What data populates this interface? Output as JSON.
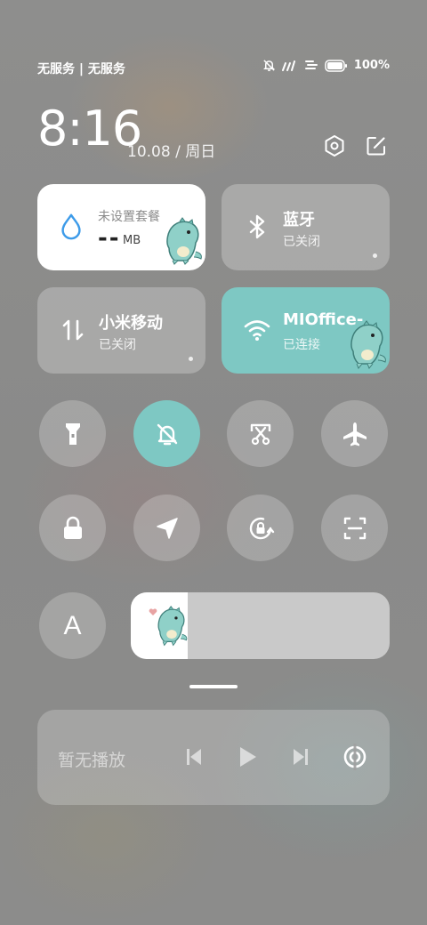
{
  "status_bar": {
    "carrier": "无服务 | 无服务",
    "battery_percent": "100%",
    "icons": [
      "dnd-off-icon",
      "signal-icon",
      "data-icon",
      "battery-icon"
    ]
  },
  "header": {
    "time": "8:16",
    "date": "10.08 / 周日",
    "icons": [
      "settings-icon",
      "edit-icon"
    ]
  },
  "tiles": {
    "data": {
      "subtitle": "未设置套餐",
      "value": "--",
      "unit": "MB",
      "icon": "water-drop-icon"
    },
    "bluetooth": {
      "title": "蓝牙",
      "status": "已关闭",
      "icon": "bluetooth-icon"
    },
    "mobile_data": {
      "title": "小米移动",
      "status": "已关闭",
      "icon": "arrows-updown-icon"
    },
    "wifi": {
      "title": "MIOffice-",
      "status": "已连接",
      "icon": "wifi-icon"
    }
  },
  "toggles": [
    {
      "name": "flashlight",
      "icon": "flashlight-icon",
      "active": false
    },
    {
      "name": "silent",
      "icon": "bell-off-icon",
      "active": true
    },
    {
      "name": "screenshot",
      "icon": "screenshot-icon",
      "active": false
    },
    {
      "name": "airplane",
      "icon": "airplane-icon",
      "active": false
    },
    {
      "name": "lock",
      "icon": "lock-icon",
      "active": false
    },
    {
      "name": "location",
      "icon": "location-icon",
      "active": false
    },
    {
      "name": "rotation-lock",
      "icon": "rotation-lock-icon",
      "active": false
    },
    {
      "name": "scan",
      "icon": "scan-icon",
      "active": false
    }
  ],
  "auto_brightness": {
    "label": "A"
  },
  "brightness": {
    "level": 0.22
  },
  "media": {
    "status": "暂无播放",
    "icons": [
      "previous-icon",
      "play-icon",
      "next-icon",
      "cast-icon"
    ]
  },
  "colors": {
    "accent": "#7ec8c3",
    "tile_bg": "rgba(255,255,255,0.25)"
  }
}
